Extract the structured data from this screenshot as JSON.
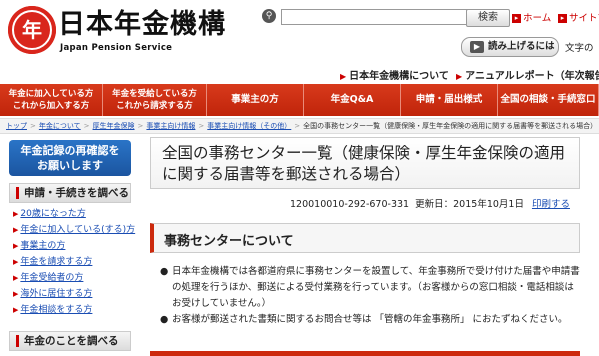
{
  "header": {
    "logo_title": "日本年金機構",
    "logo_subtitle": "Japan Pension Service",
    "logo_mark_text": "年",
    "search_button": "検索",
    "search_placeholder": "",
    "top_links": [
      "ホーム",
      "サイトマ"
    ],
    "read_aloud": "読み上げるには",
    "font_size_label": "文字の",
    "sub_links": [
      "日本年金機構について",
      "アニュアルレポート（年次報告書"
    ]
  },
  "nav": {
    "items": [
      "年金に加入している方\nこれから加入する方",
      "年金を受給している方\nこれから請求する方",
      "事業主の方",
      "年金Q&A",
      "申請・届出様式",
      "全国の相談・手続窓口"
    ]
  },
  "breadcrumb": [
    "トップ",
    "年金について",
    "厚生年金保険",
    "事業主向け情報",
    "事業主向け情報（その他）",
    "全国の事務センター一覧（健康保険・厚生年金保険の適用に関する届書等を郵送される場合）"
  ],
  "sidebar": {
    "banner": "年金記録の再確認を\nお願いします",
    "procedures_heading": "申請・手続きを調べる",
    "procedures": [
      "20歳になった方",
      "年金に加入している(する)方",
      "事業主の方",
      "年金を請求する方",
      "年金受給者の方",
      "海外に居住する方",
      "年金相談をする方"
    ],
    "learn_heading": "年金のことを調べる"
  },
  "main": {
    "title": "全国の事務センター一覧（健康保険・厚生年金保険の適用に関する届書等を郵送される場合）",
    "doc_id": "120010010-292-670-331",
    "updated": "更新日：2015年10月1日",
    "print_label": "印刷する",
    "section_title": "事務センターについて",
    "bullets": [
      "日本年金機構では各都道府県に事務センターを設置して、年金事務所で受け付けた届書や申請書の処理を行うほか、郵送による受付業務を行っています。（お客様からの窓口相談・電話相談はお受けしていません。）",
      "お客様が郵送された書類に関するお問合せ等は 「管轄の年金事務所」 におたずねください。"
    ]
  },
  "colors": {
    "brand_red": "#cc2a0e",
    "link_blue": "#1a4db3",
    "banner_blue": "#1b55a0"
  }
}
